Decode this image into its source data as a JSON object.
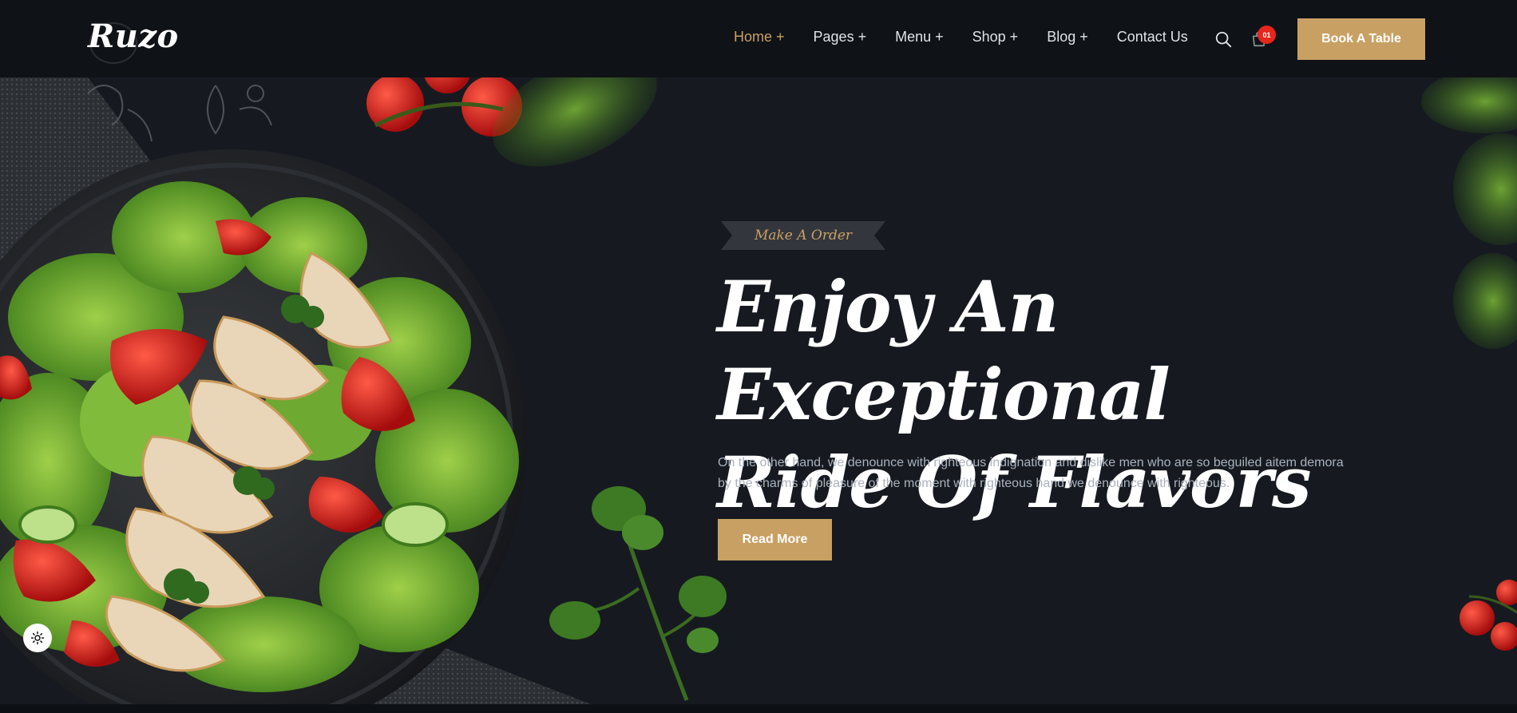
{
  "header": {
    "logo_text": "Ruzo",
    "nav": [
      {
        "label": "Home +",
        "active": true
      },
      {
        "label": "Pages +",
        "active": false
      },
      {
        "label": "Menu +",
        "active": false
      },
      {
        "label": "Shop +",
        "active": false
      },
      {
        "label": "Blog +",
        "active": false
      },
      {
        "label": "Contact Us",
        "active": false
      }
    ],
    "search_icon": "search-icon",
    "cart_icon": "shopping-bag-icon",
    "cart_count": "01",
    "book_button": "Book A Table"
  },
  "hero": {
    "tag": "Make A Order",
    "title_line1": "Enjoy An Exceptional",
    "title_line2": "Ride Of Flavors",
    "description": "On the other hand, we denounce with righteous indignation and dislike men who are so beguiled aitem demora by the charms of pleasure of the moment with righteous hand we denounce with righteous.",
    "read_more": "Read More",
    "image": "salad-bowl-with-grilled-chicken"
  },
  "theme_toggle_icon": "sun-icon",
  "colors": {
    "accent": "#c9a063",
    "background": "#161a20",
    "header_bg": "#0f1216",
    "badge": "#e7261c"
  }
}
